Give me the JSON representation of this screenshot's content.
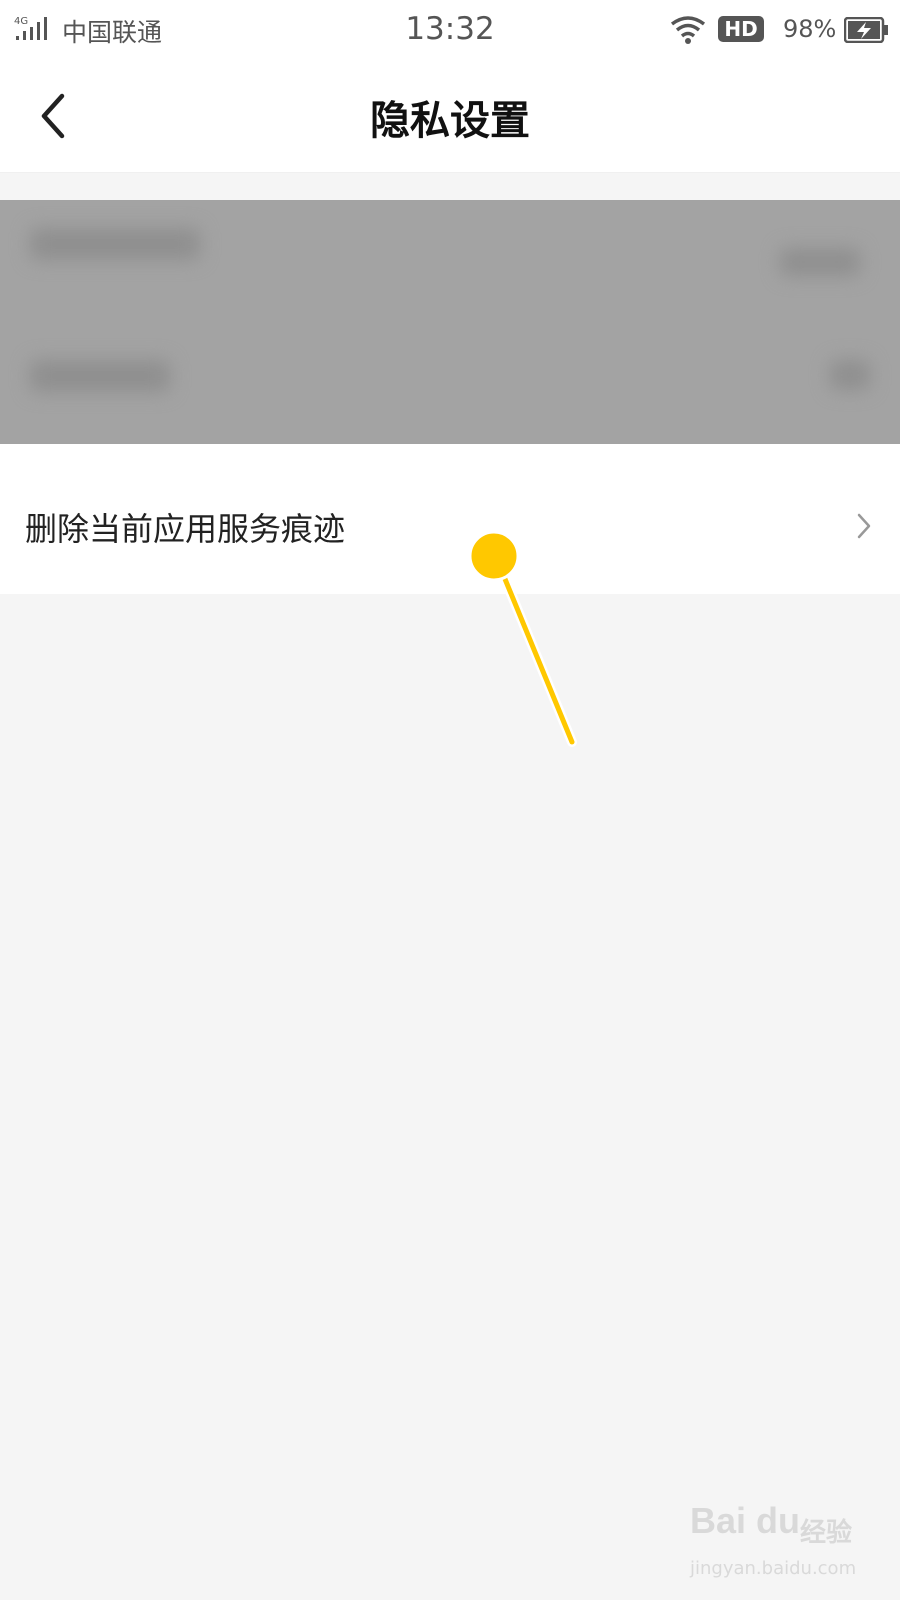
{
  "status_bar": {
    "network": "4G",
    "carrier": "中国联通",
    "time": "13:32",
    "hd_badge": "HD",
    "battery_percent": "98%",
    "icons": [
      "signal-icon",
      "wifi-icon",
      "battery-charging-icon"
    ]
  },
  "header": {
    "title": "隐私设置",
    "back_icon": "chevron-left-icon"
  },
  "list": {
    "items": [
      {
        "label": "删除当前应用服务痕迹",
        "icon": "chevron-right-icon"
      }
    ]
  },
  "watermark": {
    "brand": "Bai du",
    "sub": "经验",
    "url": "jingyan.baidu.com"
  },
  "colors": {
    "page_bg": "#f5f5f5",
    "surface": "#ffffff",
    "blur_overlay": "#a3a3a3",
    "pointer_accent": "#ffc800",
    "text_primary": "#111111"
  }
}
